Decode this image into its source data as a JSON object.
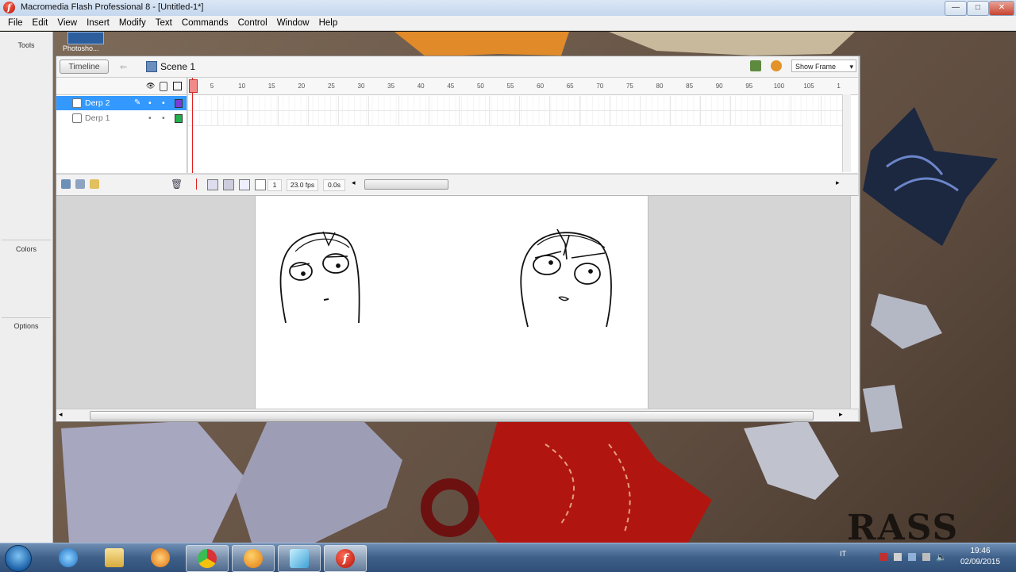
{
  "window": {
    "title": "Macromedia Flash Professional 8 - [Untitled-1*]",
    "controls": [
      "minimize",
      "maximize",
      "close"
    ]
  },
  "menubar": {
    "items": [
      "File",
      "Edit",
      "View",
      "Insert",
      "Modify",
      "Text",
      "Commands",
      "Control",
      "Window",
      "Help"
    ]
  },
  "tools_panel": {
    "sections": [
      "Tools",
      "Colors",
      "Options"
    ]
  },
  "desktop": {
    "shortcut_label": "Photosho...",
    "watermark": "RASS"
  },
  "timeline": {
    "timeline_button": "Timeline",
    "scene_label": "Scene 1",
    "view_select": "Show Frame",
    "ruler_ticks": [
      "5",
      "10",
      "15",
      "20",
      "25",
      "30",
      "35",
      "40",
      "45",
      "50",
      "55",
      "60",
      "65",
      "70",
      "75",
      "80",
      "85",
      "90",
      "95",
      "100",
      "105",
      "1"
    ],
    "layers": [
      {
        "name": "Derp 2",
        "selected": true,
        "color": "#7a3cd6"
      },
      {
        "name": "Derp 1",
        "selected": false,
        "color": "#22b14c"
      }
    ],
    "current_frame": "1",
    "frame_rate": "23.0 fps",
    "elapsed": "0.0s"
  },
  "taskbar": {
    "apps": [
      "internet-explorer",
      "file-explorer",
      "media-player",
      "chrome",
      "firefox-orb",
      "generic-app",
      "flash"
    ],
    "active_app": "flash",
    "language": "IT",
    "clock_time": "19:46",
    "clock_date": "02/09/2015"
  },
  "colors": {
    "selection_blue": "#3399ff",
    "playhead_red": "#e02020",
    "taskbar_blue": "#3d5f88"
  }
}
